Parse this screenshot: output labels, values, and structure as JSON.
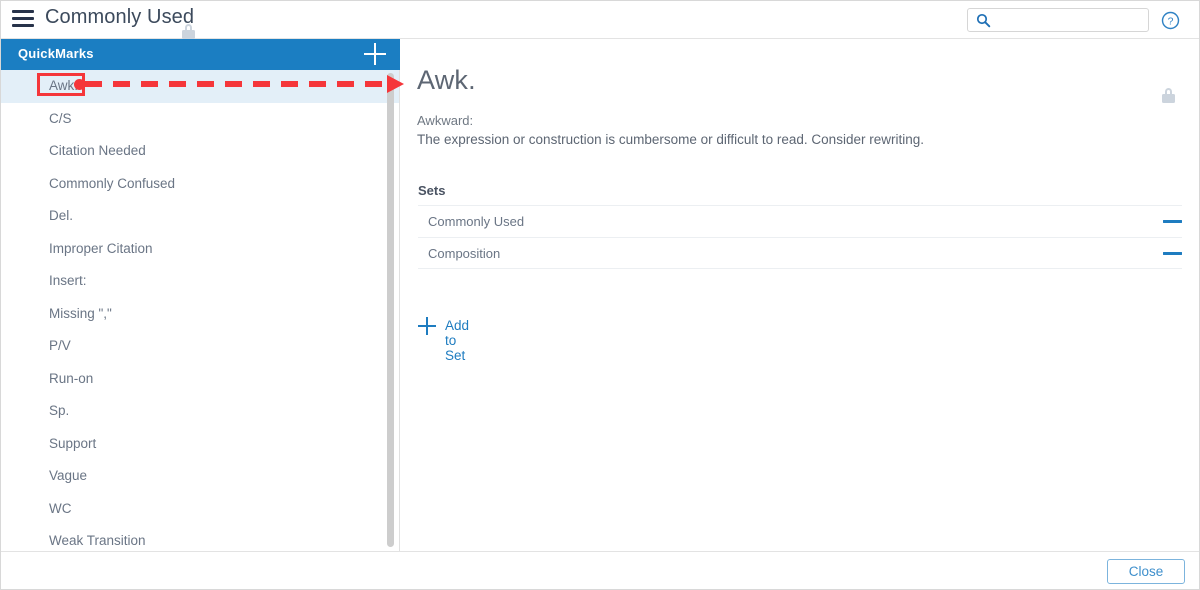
{
  "window": {
    "title": "Commonly Used",
    "title_lock_icon": "lock-icon",
    "menu_icon": "hamburger-icon",
    "help_icon": "help-circle-icon"
  },
  "search": {
    "value": "",
    "placeholder": "",
    "icon": "search-icon"
  },
  "quickmarks_panel": {
    "header": "QuickMarks",
    "add_icon": "plus-icon",
    "selected_index": 0,
    "items": [
      {
        "label": "Awk."
      },
      {
        "label": "C/S"
      },
      {
        "label": "Citation Needed"
      },
      {
        "label": "Commonly Confused"
      },
      {
        "label": "Del."
      },
      {
        "label": "Improper Citation"
      },
      {
        "label": "Insert:"
      },
      {
        "label": "Missing \",\""
      },
      {
        "label": "P/V"
      },
      {
        "label": "Run-on"
      },
      {
        "label": "Sp."
      },
      {
        "label": "Support"
      },
      {
        "label": "Vague"
      },
      {
        "label": "WC"
      },
      {
        "label": "Weak Transition"
      }
    ]
  },
  "detail": {
    "title": "Awk.",
    "lock_icon": "lock-icon",
    "description_term": "Awkward:",
    "description_body": "The expression or construction is cumbersome or difficult to read. Consider rewriting.",
    "sets_label": "Sets",
    "sets": [
      {
        "name": "Commonly Used",
        "remove_icon": "minus-icon"
      },
      {
        "name": "Composition",
        "remove_icon": "minus-icon"
      }
    ],
    "add_to_set_label": "Add to Set",
    "add_to_set_icon": "plus-icon"
  },
  "footer": {
    "close_label": "Close"
  },
  "annotation": {
    "type": "arrow-callout",
    "color": "#f5363a",
    "from": "quickmark-item-awk",
    "to": "detail-title"
  },
  "colors": {
    "header_blue": "#1b7ec2",
    "accent_blue": "#1e7cc0",
    "selected_row": "#e3eff8",
    "text_gray": "#6a7585",
    "annotation_red": "#f5363a"
  }
}
